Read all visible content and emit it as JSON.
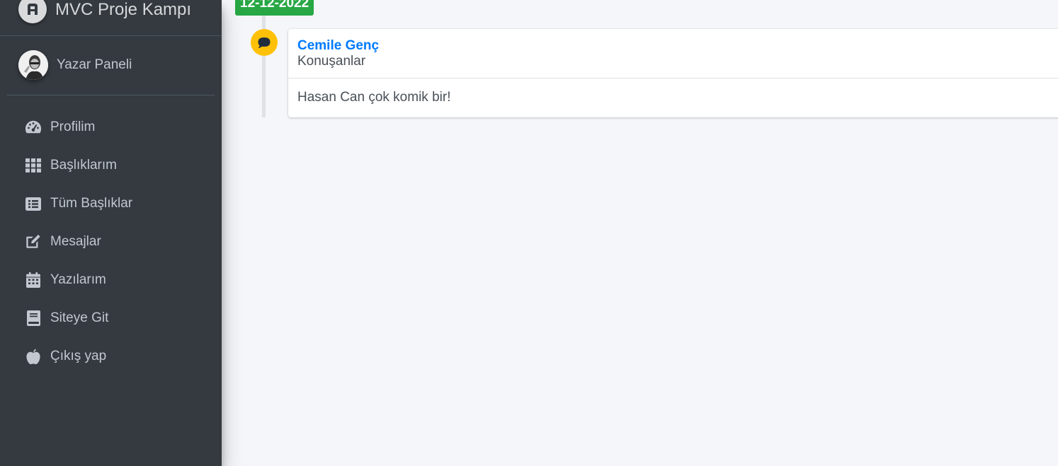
{
  "brand": {
    "title": "MVC Proje Kampı",
    "logo_icon": "adminlte-logo-icon"
  },
  "user_panel": {
    "name": "Yazar Paneli",
    "avatar_icon": "user-avatar"
  },
  "sidebar": {
    "items": [
      {
        "label": "Profilim",
        "icon": "tachometer-icon"
      },
      {
        "label": "Başlıklarım",
        "icon": "th-grid-icon"
      },
      {
        "label": "Tüm Başlıklar",
        "icon": "list-alt-icon"
      },
      {
        "label": "Mesajlar",
        "icon": "edit-icon"
      },
      {
        "label": "Yazılarım",
        "icon": "calendar-icon"
      },
      {
        "label": "Siteye Git",
        "icon": "book-icon"
      },
      {
        "label": "Çıkış yap",
        "icon": "apple-icon"
      }
    ]
  },
  "timeline": {
    "date": "12-12-2022",
    "item": {
      "icon": "comment-icon",
      "author": "Cemile Genç",
      "topic": "Konuşanlar",
      "body": "Hasan Can çok komik bir!"
    }
  },
  "colors": {
    "sidebar_bg": "#343a40",
    "content_bg": "#f4f6f9",
    "date_badge": "#28a745",
    "timeline_icon": "#ffc107",
    "link": "#007bff"
  }
}
